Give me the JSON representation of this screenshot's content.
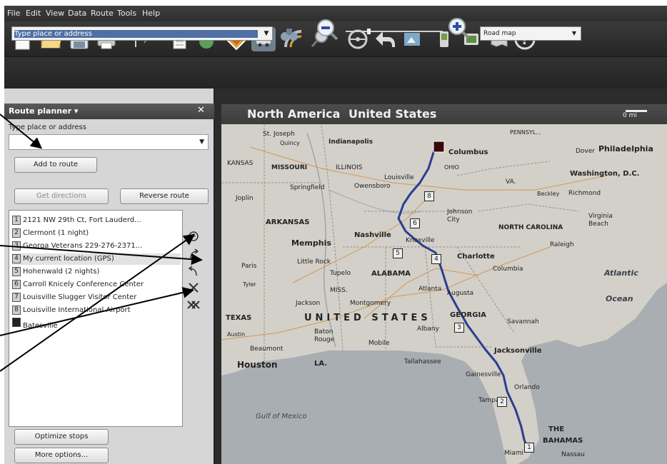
{
  "menu": [
    "File",
    "Edit",
    "View",
    "Data",
    "Route",
    "Tools",
    "Help"
  ],
  "toolbar_icons": [
    "new-document-icon",
    "open-folder-icon",
    "save-icon",
    "print-icon",
    "pushpin-icon",
    "route-itinerary-icon",
    "find-nearby-icon",
    "road-sign-icon",
    "car-icon",
    "gps-icon",
    "search-map-icon",
    "steering-wheel-icon",
    "back-arrow-icon",
    "import-icon",
    "device-icon",
    "export-icon",
    "map-book-icon",
    "help-icon"
  ],
  "search": {
    "placeholder": "Type place or address"
  },
  "map_type": {
    "selected": "Road map"
  },
  "route_planner": {
    "title": "Route planner",
    "address_label": "Type place or address",
    "add_to_route": "Add to route",
    "get_directions": "Get directions",
    "reverse_route": "Reverse route",
    "optimize_stops": "Optimize stops",
    "more_options": "More options...",
    "stops": [
      {
        "num": "1",
        "label": "2121 NW 29th Ct, Fort Lauderd..."
      },
      {
        "num": "2",
        "label": "Clermont (1 night)"
      },
      {
        "num": "3",
        "label": "Georga Veterans 229-276-2371..."
      },
      {
        "num": "4",
        "label": "My current location (GPS)"
      },
      {
        "num": "5",
        "label": "Hohenwald (2 nights)"
      },
      {
        "num": "6",
        "label": "Carroll Knicely Conference Center"
      },
      {
        "num": "7",
        "label": "Louisville Slugger Visitor Center"
      },
      {
        "num": "8",
        "label": "Louisville International Airport"
      },
      {
        "num": "",
        "label": "Batesville"
      }
    ]
  },
  "map": {
    "crumbs": [
      "North America",
      "United States"
    ],
    "scale": "0 mi",
    "labels": {
      "st_joseph": "St. Joseph",
      "quincy": "Quincy",
      "indianapolis": "Indianapolis",
      "columbus": "Columbus",
      "pennsylvania": "PENNSYL...",
      "dover": "Dover",
      "philadelphia": "Philadelphia",
      "kansas": "KANSAS",
      "missouri": "MISSOURI",
      "illinois": "ILLINOIS",
      "louisville": "Louisville",
      "ohio": "OHIO",
      "washington": "Washington, D.C.",
      "va": "VA.",
      "joplin": "Joplin",
      "springfield": "Springfield",
      "owensboro": "Owensboro",
      "johnson_city": "Johnson City",
      "beckley": "Beckley",
      "richmond": "Richmond",
      "arkansas": "ARKANSAS",
      "nashville": "Nashville",
      "knoxville": "Knoxville",
      "north_carolina": "NORTH CAROLINA",
      "virginia_beach": "Virginia Beach",
      "memphis": "Memphis",
      "charlotte": "Charlotte",
      "raleigh": "Raleigh",
      "paris": "Paris",
      "little_rock": "Little Rock",
      "tupelo": "Tupelo",
      "alabama": "ALABAMA",
      "columbia": "Columbia",
      "atlantic": "Atlantic",
      "ocean": "Ocean",
      "tyler": "Tyler",
      "miss": "MISS.",
      "atlanta": "Atlanta",
      "augusta": "Augusta",
      "texas": "TEXAS",
      "jackson": "Jackson",
      "montgomery": "Montgomery",
      "united_states": "UNITED STATES",
      "georgia": "GEORGIA",
      "savannah": "Savannah",
      "baton_rouge": "Baton Rouge",
      "albany": "Albany",
      "austin": "Austin",
      "beaumont": "Beaumont",
      "mobile": "Mobile",
      "jacksonville": "Jacksonville",
      "houston": "Houston",
      "la": "LA.",
      "tallahassee": "Tallahassee",
      "gainesville": "Gainesville",
      "orlando": "Orlando",
      "tampa": "Tampa",
      "gulf_of_mexico": "Gulf of Mexico",
      "the": "THE",
      "bahamas": "BAHAMAS",
      "miami": "Miami",
      "nassau": "Nassau"
    },
    "markers": [
      "1",
      "2",
      "3",
      "4",
      "5",
      "6",
      "8"
    ]
  }
}
